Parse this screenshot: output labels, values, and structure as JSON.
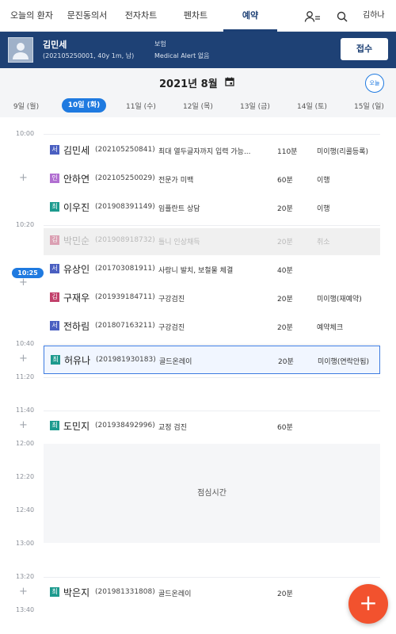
{
  "nav": {
    "tabs": [
      {
        "label": "오늘의 환자"
      },
      {
        "label": "문진동의서"
      },
      {
        "label": "전자차트"
      },
      {
        "label": "펜차트"
      },
      {
        "label": "예약"
      }
    ],
    "user_name": "김하나"
  },
  "patient": {
    "name": "김민세",
    "info": "(202105250001, 40y 1m, 남)",
    "insurance_label": "보험",
    "medical_alert": "Medical Alert 없음",
    "receipt_button": "접수"
  },
  "calendar": {
    "month_title": "2021년 8월",
    "today_button": "오늘",
    "days": [
      {
        "label": "9일 (월)"
      },
      {
        "label": "10일 (화)"
      },
      {
        "label": "11일 (수)"
      },
      {
        "label": "12일 (목)"
      },
      {
        "label": "13일 (금)"
      },
      {
        "label": "14일 (토)"
      },
      {
        "label": "15일 (일)"
      }
    ],
    "selected_day_index": 1
  },
  "schedule": {
    "current_time": "10:25",
    "time_labels": [
      "10:00",
      "10:20",
      "10:40",
      "11:20",
      "11:40",
      "12:00",
      "12:20",
      "12:40",
      "13:00",
      "13:20",
      "13:40"
    ],
    "lunch_label": "점심시간",
    "appointments": [
      {
        "badge": "서",
        "badge_color": "#4a5fc1",
        "name": "김민세",
        "pid": "(202105250841)",
        "memo": "최대 열두글자까지 입력 가능...",
        "duration": "110분",
        "status": "미이행(리콜등록)"
      },
      {
        "badge": "인",
        "badge_color": "#b16fd1",
        "name": "안하연",
        "pid": "(202105250029)",
        "memo": "전문가 미백",
        "duration": "60분",
        "status": "이행"
      },
      {
        "badge": "최",
        "badge_color": "#1d9a8e",
        "name": "이우진",
        "pid": "(201908391149)",
        "memo": "임플란트 상담",
        "duration": "20분",
        "status": "이행"
      },
      {
        "badge": "김",
        "badge_color": "#c2416b",
        "name": "박민순",
        "pid": "(201908918732)",
        "memo": "틀니 인상채득",
        "duration": "20분",
        "status": "취소"
      },
      {
        "badge": "서",
        "badge_color": "#4a5fc1",
        "name": "유상인",
        "pid": "(201703081911)",
        "memo": "사랑니 발치, 보철물 체결",
        "duration": "40분",
        "status": ""
      },
      {
        "badge": "김",
        "badge_color": "#c2416b",
        "name": "구재우",
        "pid": "(201939184711)",
        "memo": "구강검진",
        "duration": "20분",
        "status": "미이행(재예약)"
      },
      {
        "badge": "서",
        "badge_color": "#4a5fc1",
        "name": "전하림",
        "pid": "(201807163211)",
        "memo": "구강검진",
        "duration": "20분",
        "status": "예약체크"
      },
      {
        "badge": "최",
        "badge_color": "#1d9a8e",
        "name": "허유나",
        "pid": "(201981930183)",
        "memo": "골드온레이",
        "duration": "20분",
        "status": "미이행(연락안됨)"
      },
      {
        "badge": "최",
        "badge_color": "#1d9a8e",
        "name": "도민지",
        "pid": "(201938492996)",
        "memo": "교정 검진",
        "duration": "60분",
        "status": ""
      },
      {
        "badge": "최",
        "badge_color": "#1d9a8e",
        "name": "박은지",
        "pid": "(201981331808)",
        "memo": "골드온레이",
        "duration": "20분",
        "status": ""
      }
    ]
  },
  "fab_icon": "plus-icon"
}
